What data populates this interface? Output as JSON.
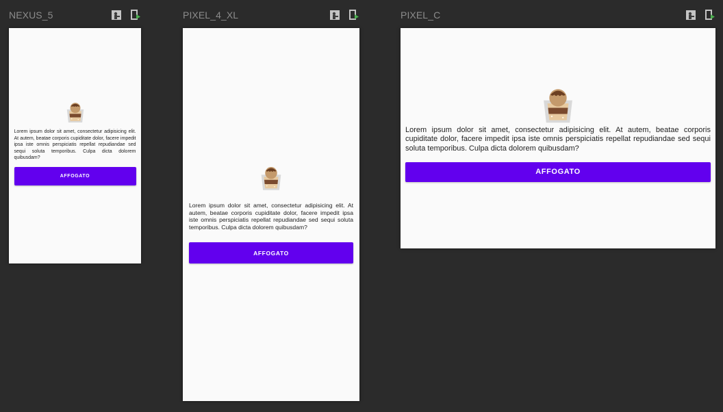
{
  "colors": {
    "canvas_bg": "#2b2b2b",
    "device_label": "#8c8c8c",
    "screen_bg": "#fafafa",
    "button_bg": "#6200ee",
    "button_text": "#ffffff"
  },
  "header_icons": [
    "switch-orientation-icon",
    "device-run-icon"
  ],
  "devices": [
    {
      "name": "NEXUS_5",
      "description": "Lorem ipsum dolor sit amet, consectetur adipisicing elit. At autem, beatae corporis cupiditate dolor, facere impedit ipsa iste omnis perspiciatis repellat repudiandae sed sequi soluta temporibus. Culpa dicta dolorem quibusdam?",
      "button_label": "AFFOGATO"
    },
    {
      "name": "PIXEL_4_XL",
      "description": "Lorem ipsum dolor sit amet, consectetur adipisicing elit. At autem, beatae corporis cupiditate dolor, facere impedit ipsa iste omnis perspiciatis repellat repudiandae sed sequi soluta temporibus. Culpa dicta dolorem quibusdam?",
      "button_label": "AFFOGATO"
    },
    {
      "name": "PIXEL_C",
      "description": "Lorem ipsum dolor sit amet, consectetur adipisicing elit. At autem, beatae corporis cupiditate dolor, facere impedit ipsa iste omnis perspiciatis repellat repudiandae sed sequi soluta temporibus. Culpa dicta dolorem quibusdam?",
      "button_label": "AFFOGATO"
    }
  ]
}
